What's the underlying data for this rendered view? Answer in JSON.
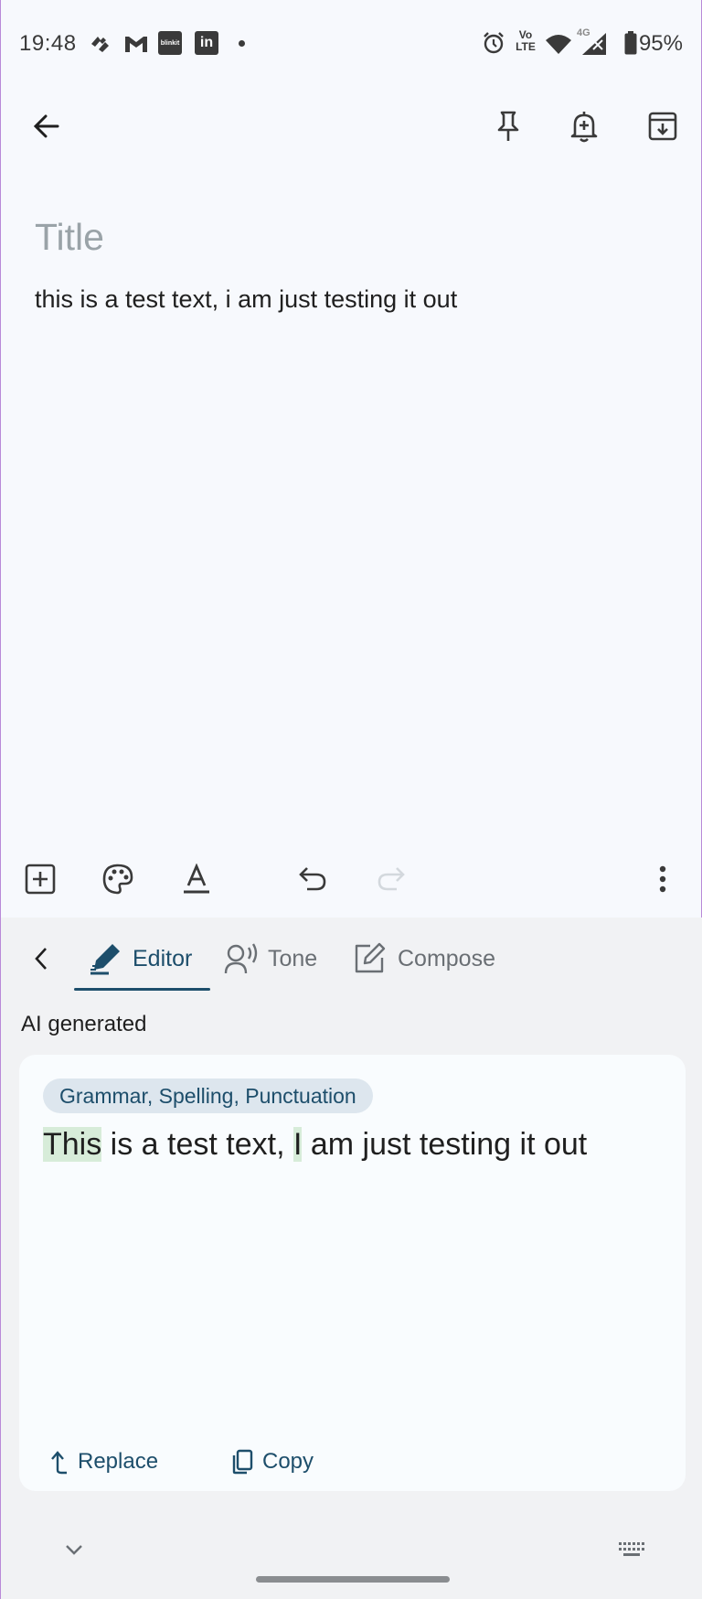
{
  "status_bar": {
    "time": "19:48",
    "battery_percent": "95%",
    "battery_level": 0.95,
    "icons": [
      "swiggy-icon",
      "gmail-icon",
      "blinkit-icon",
      "linkedin-icon",
      "dot-icon",
      "alarm-icon",
      "volte-icon",
      "wifi-icon",
      "signal-4g-icon",
      "battery-icon"
    ],
    "blinkit_label": "blinkit",
    "linkedin_label": "in",
    "volte_label_top": "Vo",
    "volte_label_bottom": "LTE",
    "network_label": "4G"
  },
  "top_bar": {
    "icons": [
      "back-arrow-icon",
      "pin-icon",
      "reminder-bell-icon",
      "archive-icon"
    ]
  },
  "note": {
    "title_placeholder": "Title",
    "body": "this is a test text, i am just testing it out"
  },
  "bottom_toolbar": {
    "icons": [
      "add-box-icon",
      "palette-icon",
      "text-format-icon",
      "undo-icon",
      "redo-icon",
      "more-vert-icon"
    ]
  },
  "assistant": {
    "tabs": [
      {
        "label": "Editor",
        "icon": "pen-icon",
        "active": true
      },
      {
        "label": "Tone",
        "icon": "tone-icon",
        "active": false
      },
      {
        "label": "Compose",
        "icon": "compose-icon",
        "active": false
      }
    ],
    "ai_label": "AI generated",
    "chip": "Grammar, Spelling, Punctuation",
    "result": {
      "seg1": "This",
      "seg2": " is a test text, ",
      "seg3": "I",
      "seg4": " am just testing it out"
    },
    "actions": {
      "replace": "Replace",
      "copy": "Copy"
    }
  },
  "colors": {
    "accent": "#1d4e6b",
    "highlight": "#d7ecd9",
    "panel_bg": "#f1f2f4",
    "page_bg": "#f7f9fd"
  }
}
